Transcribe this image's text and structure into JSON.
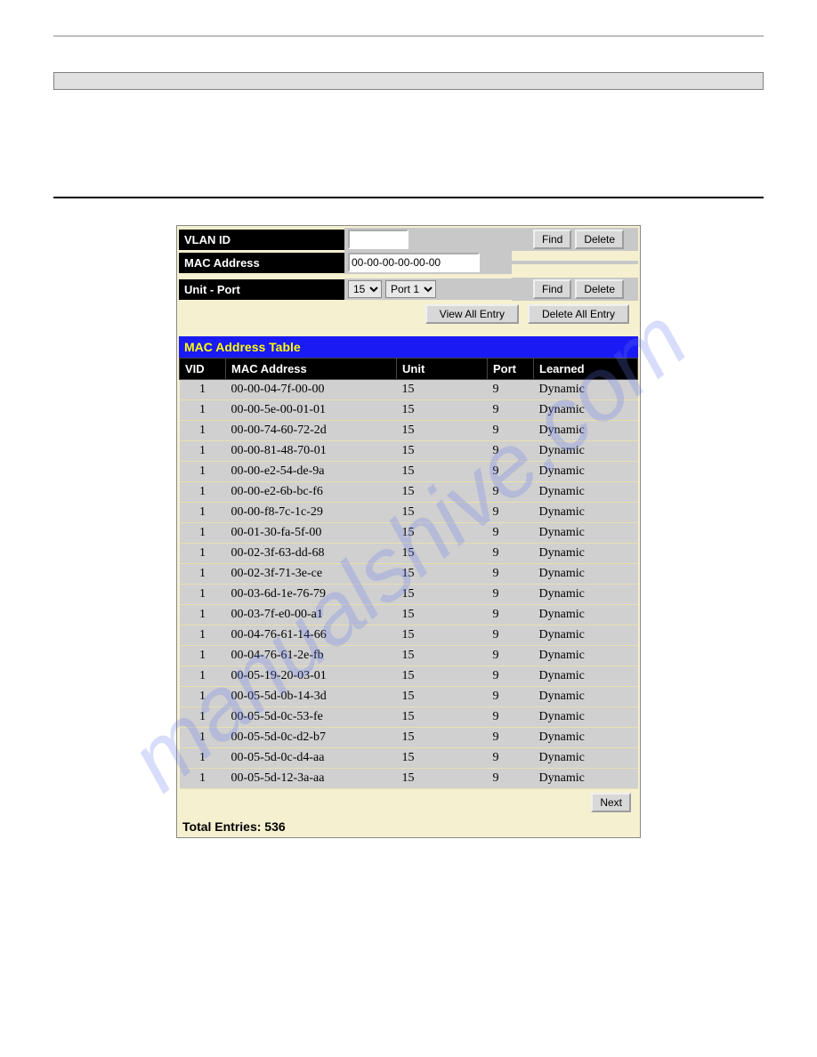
{
  "form": {
    "vlan_id_label": "VLAN ID",
    "vlan_id_value": "",
    "mac_address_label": "MAC Address",
    "mac_address_value": "00-00-00-00-00-00",
    "unit_port_label": "Unit - Port",
    "unit_select_value": "15",
    "port_select_value": "Port 1",
    "find_label": "Find",
    "delete_label": "Delete",
    "view_all_label": "View All Entry",
    "delete_all_label": "Delete All Entry"
  },
  "table": {
    "title": "MAC Address Table",
    "headers": {
      "vid": "VID",
      "mac": "MAC Address",
      "unit": "Unit",
      "port": "Port",
      "learned": "Learned"
    },
    "rows": [
      {
        "vid": "1",
        "mac": "00-00-04-7f-00-00",
        "unit": "15",
        "port": "9",
        "learned": "Dynamic"
      },
      {
        "vid": "1",
        "mac": "00-00-5e-00-01-01",
        "unit": "15",
        "port": "9",
        "learned": "Dynamic"
      },
      {
        "vid": "1",
        "mac": "00-00-74-60-72-2d",
        "unit": "15",
        "port": "9",
        "learned": "Dynamic"
      },
      {
        "vid": "1",
        "mac": "00-00-81-48-70-01",
        "unit": "15",
        "port": "9",
        "learned": "Dynamic"
      },
      {
        "vid": "1",
        "mac": "00-00-e2-54-de-9a",
        "unit": "15",
        "port": "9",
        "learned": "Dynamic"
      },
      {
        "vid": "1",
        "mac": "00-00-e2-6b-bc-f6",
        "unit": "15",
        "port": "9",
        "learned": "Dynamic"
      },
      {
        "vid": "1",
        "mac": "00-00-f8-7c-1c-29",
        "unit": "15",
        "port": "9",
        "learned": "Dynamic"
      },
      {
        "vid": "1",
        "mac": "00-01-30-fa-5f-00",
        "unit": "15",
        "port": "9",
        "learned": "Dynamic"
      },
      {
        "vid": "1",
        "mac": "00-02-3f-63-dd-68",
        "unit": "15",
        "port": "9",
        "learned": "Dynamic"
      },
      {
        "vid": "1",
        "mac": "00-02-3f-71-3e-ce",
        "unit": "15",
        "port": "9",
        "learned": "Dynamic"
      },
      {
        "vid": "1",
        "mac": "00-03-6d-1e-76-79",
        "unit": "15",
        "port": "9",
        "learned": "Dynamic"
      },
      {
        "vid": "1",
        "mac": "00-03-7f-e0-00-a1",
        "unit": "15",
        "port": "9",
        "learned": "Dynamic"
      },
      {
        "vid": "1",
        "mac": "00-04-76-61-14-66",
        "unit": "15",
        "port": "9",
        "learned": "Dynamic"
      },
      {
        "vid": "1",
        "mac": "00-04-76-61-2e-fb",
        "unit": "15",
        "port": "9",
        "learned": "Dynamic"
      },
      {
        "vid": "1",
        "mac": "00-05-19-20-03-01",
        "unit": "15",
        "port": "9",
        "learned": "Dynamic"
      },
      {
        "vid": "1",
        "mac": "00-05-5d-0b-14-3d",
        "unit": "15",
        "port": "9",
        "learned": "Dynamic"
      },
      {
        "vid": "1",
        "mac": "00-05-5d-0c-53-fe",
        "unit": "15",
        "port": "9",
        "learned": "Dynamic"
      },
      {
        "vid": "1",
        "mac": "00-05-5d-0c-d2-b7",
        "unit": "15",
        "port": "9",
        "learned": "Dynamic"
      },
      {
        "vid": "1",
        "mac": "00-05-5d-0c-d4-aa",
        "unit": "15",
        "port": "9",
        "learned": "Dynamic"
      },
      {
        "vid": "1",
        "mac": "00-05-5d-12-3a-aa",
        "unit": "15",
        "port": "9",
        "learned": "Dynamic"
      }
    ],
    "next_label": "Next",
    "total_entries_label": "Total Entries: 536"
  }
}
